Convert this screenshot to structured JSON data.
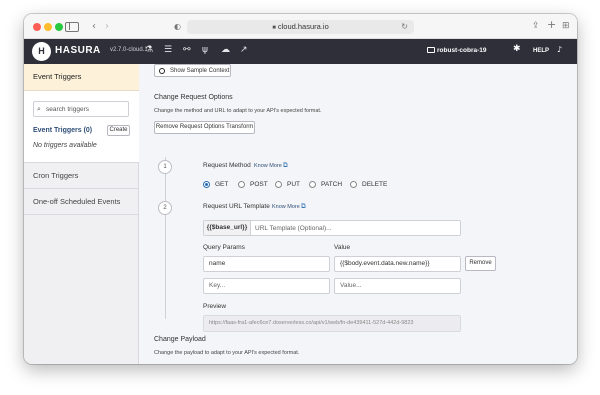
{
  "browser": {
    "url": "cloud.hasura.io"
  },
  "header": {
    "brand": "HASURA",
    "version": "v2.7.0-cloud.1",
    "project": "robust-cobra-19",
    "help": "HELP",
    "nav_icons": [
      "flask-icon",
      "database-icon",
      "relationship-icon",
      "events-icon",
      "cloud-icon",
      "chart-icon"
    ]
  },
  "sidebar": {
    "event_triggers_title": "Event Triggers",
    "search_placeholder": "search triggers",
    "count_label": "Event Triggers (0)",
    "create_label": "Create",
    "empty_text": "No triggers available",
    "cron_title": "Cron Triggers",
    "oneoff_title": "One-off Scheduled Events"
  },
  "main": {
    "show_sample_context": "Show Sample Context",
    "change_request_title": "Change Request Options",
    "change_request_desc": "Change the method and URL to adapt to your API's expected format.",
    "remove_transform_label": "Remove Request Options Transform",
    "step1": "1",
    "step2": "2",
    "request_method_label": "Request Method",
    "know_more": "Know More",
    "methods": [
      {
        "label": "GET",
        "selected": true
      },
      {
        "label": "POST",
        "selected": false
      },
      {
        "label": "PUT",
        "selected": false
      },
      {
        "label": "PATCH",
        "selected": false
      },
      {
        "label": "DELETE",
        "selected": false
      }
    ],
    "url_template_label": "Request URL Template",
    "base_url_addon": "{{$base_url}}",
    "url_template_placeholder": "URL Template (Optional)...",
    "query_params_label": "Query Params",
    "value_label": "Value",
    "param_rows": [
      {
        "key": "name",
        "value": "{{$body.event.data.new.name}}"
      },
      {
        "key": "",
        "value": ""
      }
    ],
    "key_placeholder": "Key...",
    "value_placeholder": "Value...",
    "remove_label": "Remove",
    "preview_label": "Preview",
    "preview_value": "https://faas-fra1-afec6ce7.doserverless.co/api/v1/web/fn-de439411-527d-442d-9823",
    "change_payload_title": "Change Payload",
    "change_payload_desc": "Change the payload to adapt to your API's expected format."
  },
  "colors": {
    "header_bg": "#2f2f3a",
    "active_sidebar_bg": "#fdf2d9",
    "link": "#2f4f77",
    "radio_selected": "#2a6fb3"
  }
}
